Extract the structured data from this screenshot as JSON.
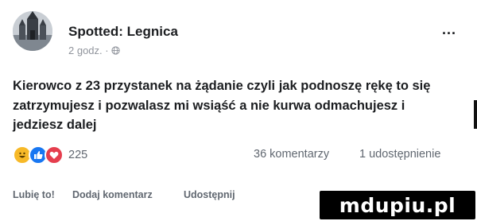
{
  "post": {
    "page_name": "Spotted: Legnica",
    "time": "2 godz. ·",
    "more_label": "...",
    "text": "Kierowco z 23 przystanek na żądanie czyli jak podnoszę rękę to się zatrzymujesz i pozwalasz mi wsiąść a nie kurwa odmachujesz i jedziesz dalej"
  },
  "stats": {
    "reaction_icons": [
      "haha-icon",
      "like-icon",
      "love-icon"
    ],
    "reaction_count": "225",
    "comments": "36 komentarzy",
    "shares": "1 udostępnienie"
  },
  "actions": {
    "like": "Lubię to!",
    "comment": "Dodaj komentarz",
    "share": "Udostępnij"
  },
  "watermark": {
    "text": "mdupiu.pl"
  },
  "colors": {
    "secondary_text": "#606770",
    "like_blue": "#1877f2",
    "haha_yellow": "#f7b928",
    "love_red": "#e53e4e"
  }
}
